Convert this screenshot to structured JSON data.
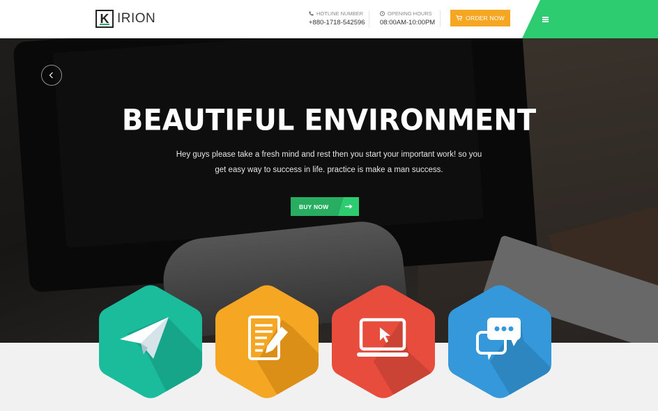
{
  "header": {
    "logo_letter": "K",
    "logo_text": "IRION",
    "hotline": {
      "label": "HOTLINE NUMBER",
      "value": "+880-1718-542596"
    },
    "hours": {
      "label": "OPENING HOURS",
      "value": "08:00AM-10:00PM"
    },
    "order_button": "ORDER NOW",
    "accent_color": "#2ecc71",
    "order_color": "#f5a623"
  },
  "hero": {
    "title": "BEAUTIFUL ENVIRONMENT",
    "subtitle": "Hey guys please take a fresh mind and rest then you start your important work! so you get easy way to success in life. practice is make a man success.",
    "cta": "BUY NOW",
    "cta_color": "#27ae60"
  },
  "features": [
    {
      "icon": "paper-plane-icon",
      "color": "#1abc9c"
    },
    {
      "icon": "document-edit-icon",
      "color": "#f5a623"
    },
    {
      "icon": "monitor-cursor-icon",
      "color": "#e74c3c"
    },
    {
      "icon": "chat-bubbles-icon",
      "color": "#3498db"
    }
  ]
}
